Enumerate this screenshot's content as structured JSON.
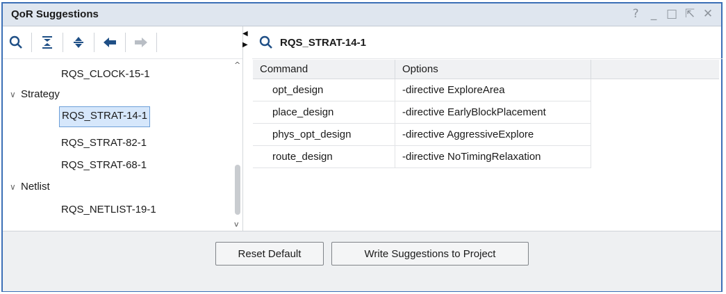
{
  "window": {
    "title": "QoR Suggestions",
    "controls": [
      "?",
      "_",
      "□",
      "⇱",
      "✕"
    ]
  },
  "left_toolbar": {
    "icons": [
      "search-icon",
      "collapse-all-icon",
      "expand-all-icon",
      "back-arrow-icon",
      "forward-arrow-icon"
    ]
  },
  "tree": {
    "items": [
      {
        "label": "RQS_CLOCK-15-1",
        "level": 2
      },
      {
        "label": "Strategy",
        "level": 1,
        "expanded": true
      },
      {
        "label": "RQS_STRAT-14-1",
        "level": 2,
        "selected": true
      },
      {
        "label": "RQS_STRAT-82-1",
        "level": 2
      },
      {
        "label": "RQS_STRAT-68-1",
        "level": 2
      },
      {
        "label": "Netlist",
        "level": 1,
        "expanded": true
      },
      {
        "label": "RQS_NETLIST-19-1",
        "level": 2
      }
    ]
  },
  "detail": {
    "header": "RQS_STRAT-14-1",
    "columns": [
      "Command",
      "Options"
    ],
    "rows": [
      [
        "opt_design",
        "-directive ExploreArea"
      ],
      [
        "place_design",
        "-directive EarlyBlockPlacement"
      ],
      [
        "phys_opt_design",
        "-directive AggressiveExplore"
      ],
      [
        "route_design",
        "-directive NoTimingRelaxation"
      ]
    ]
  },
  "footer": {
    "reset_label": "Reset Default",
    "write_label": "Write Suggestions to Project"
  },
  "colors": {
    "frame_border": "#3b6fb6",
    "titlebar_bg": "#dfe6ef",
    "selection_bg": "#d6e7fb",
    "accent_icon": "#1f4f86"
  }
}
